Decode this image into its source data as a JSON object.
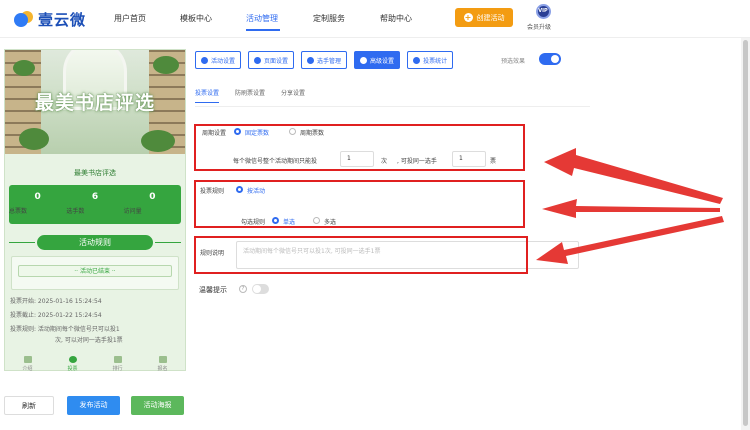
{
  "app": {
    "logo_text": "壹云微"
  },
  "nav": {
    "items": [
      {
        "label": "用户首页"
      },
      {
        "label": "模板中心"
      },
      {
        "label": "活动管理"
      },
      {
        "label": "定制服务"
      },
      {
        "label": "帮助中心"
      }
    ],
    "create_label": "创建活动",
    "vip_badge": "VIP",
    "vip_label": "会员升级"
  },
  "preview": {
    "banner_title": "最美书店评选",
    "shop_name": "最美书店评选",
    "stats": [
      {
        "value": "0",
        "label": "总票数"
      },
      {
        "value": "6",
        "label": "选手数"
      },
      {
        "value": "0",
        "label": "访问量"
      }
    ],
    "rule_heading": "活动规则",
    "ended_text": "·· 活动已结束 ··",
    "info": {
      "start": "投票开始: 2025-01-16 15:24:54",
      "end": "投票截止: 2025-01-22 15:24:54",
      "rule_line1": "投票规则: 活动期间每个微信号只可以投1",
      "rule_line2": "次, 可以对同一选手投1票"
    },
    "tabs": [
      {
        "label": "介绍"
      },
      {
        "label": "投票"
      },
      {
        "label": "排行"
      },
      {
        "label": "报名"
      }
    ]
  },
  "buttons": {
    "refresh": "刷新",
    "publish": "发布活动",
    "poster": "活动海报"
  },
  "toolbar": {
    "items": [
      {
        "label": "活动设置"
      },
      {
        "label": "页面设置"
      },
      {
        "label": "选手管理"
      },
      {
        "label": "高级设置"
      },
      {
        "label": "投票统计"
      }
    ],
    "preselect_label": "预选效果"
  },
  "subtabs": [
    {
      "label": "投票设置"
    },
    {
      "label": "防刷票设置"
    },
    {
      "label": "分享设置"
    }
  ],
  "settings": {
    "cycle_label": "周期设置",
    "cycle_opt1": "固定票数",
    "cycle_opt2": "周期票数",
    "per_user_prefix": "每个微信号整个活动期间只能投",
    "per_user_value": "1",
    "per_user_unit": "次",
    "per_player_prefix": ", 可投同一选手",
    "per_player_value": "1",
    "per_player_unit": "票",
    "rule_label": "投票规则",
    "rule_opt": "按活动",
    "check_label": "勾选规则",
    "check_opt1": "单选",
    "check_opt2": "多选",
    "desc_label": "规则说明",
    "desc_placeholder": "活动期间每个微信号只可以投1次, 可投同一选手1票",
    "reminder_label": "温馨提示",
    "help_icon": "?"
  }
}
